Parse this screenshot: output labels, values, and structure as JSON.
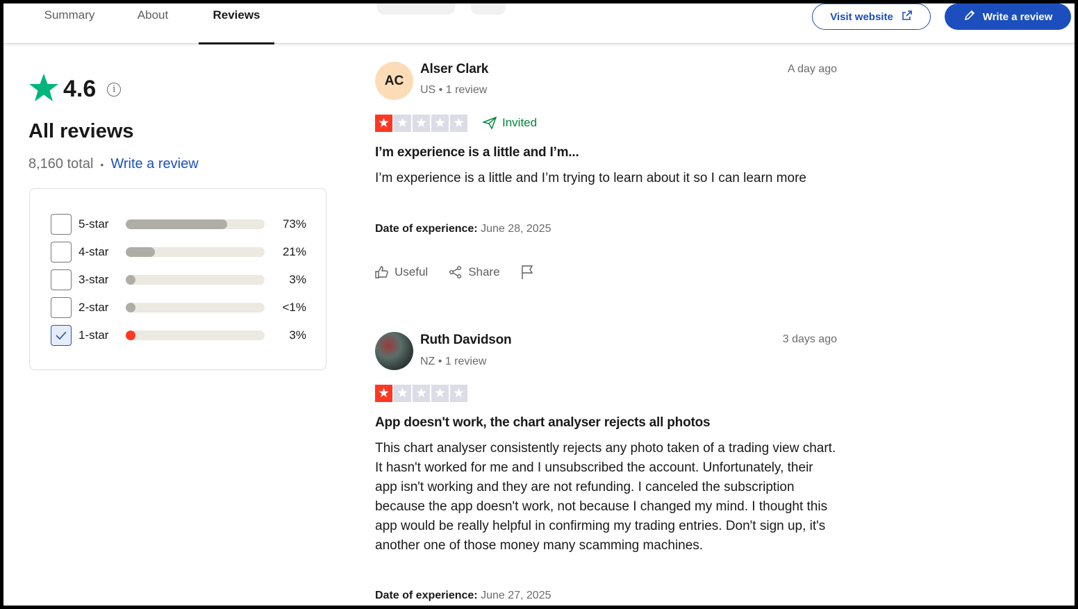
{
  "tabs": [
    {
      "label": "Summary"
    },
    {
      "label": "About"
    },
    {
      "label": "Reviews",
      "active": true
    }
  ],
  "header": {
    "visit_website": "Visit website",
    "write_review": "Write a review"
  },
  "summary": {
    "rating": "4.6",
    "info_glyph": "i",
    "heading": "All reviews",
    "total": "8,160 total",
    "separator": "•",
    "write_link": "Write a review"
  },
  "distribution": [
    {
      "label": "5-star",
      "percent": "73%",
      "fill": 0.73,
      "checked": false
    },
    {
      "label": "4-star",
      "percent": "21%",
      "fill": 0.21,
      "checked": false
    },
    {
      "label": "3-star",
      "percent": "3%",
      "fill": 0.03,
      "checked": false
    },
    {
      "label": "2-star",
      "percent": "<1%",
      "fill": 0.01,
      "checked": false
    },
    {
      "label": "1-star",
      "percent": "3%",
      "fill": 0.03,
      "checked": true
    }
  ],
  "reviews": [
    {
      "initials": "AC",
      "name": "Alser Clark",
      "meta": "US • 1 review",
      "date": "A day ago",
      "stars": 1,
      "invited": "Invited",
      "title": "I’m experience is a little and I’m...",
      "body": "I’m experience is a little and I’m trying to learn about it so I can learn more",
      "doe_label": "Date of experience:",
      "doe_value": "June 28, 2025",
      "actions": {
        "useful": "Useful",
        "share": "Share"
      }
    },
    {
      "initials": "",
      "name": "Ruth Davidson",
      "meta": "NZ • 1 review",
      "date": "3 days ago",
      "stars": 1,
      "title": "App doesn't work, the chart analyser rejects all photos",
      "body": "This chart analyser consistently rejects any photo taken of a trading view chart. It hasn't worked for me and I unsubscribed the account. Unfortunately, their app isn't working and they are not refunding. I canceled the subscription because the app doesn't work, not because I changed my mind. I thought this app would be really helpful in confirming my trading entries. Don't sign up, it's another one of those money many scamming machines.",
      "doe_label": "Date of experience:",
      "doe_value": "June 27, 2025"
    }
  ],
  "colors": {
    "brand_green": "#00b67a",
    "link_blue": "#1c4fbd",
    "star_red": "#ff3722",
    "invited_green": "#04853d"
  },
  "icons": [
    "trustpilot-star-icon",
    "info-icon",
    "external-link-icon",
    "pencil-icon",
    "check-icon",
    "send-icon",
    "thumbs-up-icon",
    "share-icon",
    "flag-icon"
  ]
}
